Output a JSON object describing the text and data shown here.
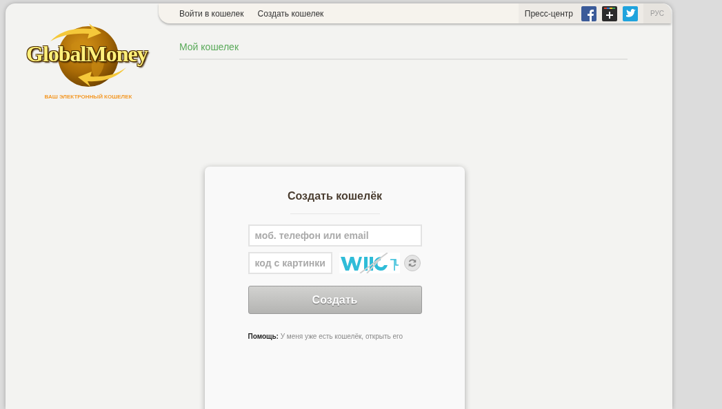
{
  "nav": {
    "links": [
      {
        "label": "Войти в кошелек"
      },
      {
        "label": "Создать кошелек"
      }
    ],
    "press": "Пресс-центр",
    "social": [
      {
        "kind": "facebook"
      },
      {
        "kind": "googleplus"
      },
      {
        "kind": "twitter"
      }
    ],
    "language": {
      "label": "РУС",
      "selected": true
    }
  },
  "logo": {
    "name": "GlobalMoney",
    "tagline": "ВАШ ЭЛЕКТРОННЫЙ КОШЕЛЕК"
  },
  "section_title": "Мой кошелек",
  "form": {
    "title": "Создать кошелёк",
    "login_placeholder": "моб. телефон или email",
    "captcha_placeholder": "код с картинки",
    "submit": "Создать",
    "help_label": "Помощь:",
    "help_link": "У меня уже есть кошелёк, открыть его"
  }
}
